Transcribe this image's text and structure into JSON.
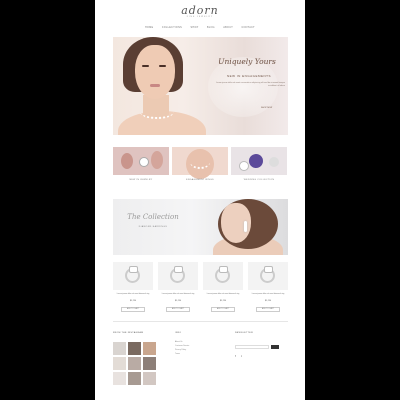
{
  "site": {
    "logo": "adorn",
    "tagline": "FINE JEWELRY"
  },
  "nav": [
    "HOME",
    "COLLECTIONS",
    "SHOP",
    "BLOG",
    "ABOUT",
    "CONTACT"
  ],
  "hero": {
    "title": "Uniquely Yours",
    "subtitle": "NEW IN ENGAGEMENTS",
    "text": "Lorem ipsum dolor sit amet consectetur adipiscing elit sed do eiusmod tempor incididunt ut labore",
    "link": "SHOP NOW"
  },
  "promos": [
    {
      "caption": "NEW IN JEWELRY",
      "bg": "#dfc3c0"
    },
    {
      "caption": "ENGAGEMENT RINGS",
      "bg": "#f0d9cf"
    },
    {
      "caption": "WEDDING COLLECTION",
      "bg": "#e9e3e6"
    }
  ],
  "banner": {
    "title": "The Collection",
    "subtitle": "DIAMOND EARRINGS"
  },
  "products": [
    {
      "name": "Lorem ipsum dolor sit amet diamond ring",
      "price": "$1,250",
      "button": "ADD TO CART"
    },
    {
      "name": "Lorem ipsum dolor sit amet diamond ring",
      "price": "$1,250",
      "button": "ADD TO CART"
    },
    {
      "name": "Lorem ipsum dolor sit amet diamond ring",
      "price": "$1,250",
      "button": "ADD TO CART"
    },
    {
      "name": "Lorem ipsum dolor sit amet diamond ring",
      "price": "$1,250",
      "button": "ADD TO CART"
    }
  ],
  "footer": {
    "gallery_title": "FROM THE INSTAGRAM",
    "links_title": "INFO",
    "links": [
      "About Us",
      "Customer Service",
      "Privacy Policy",
      "Terms"
    ],
    "newsletter_title": "NEWSLETTER"
  }
}
